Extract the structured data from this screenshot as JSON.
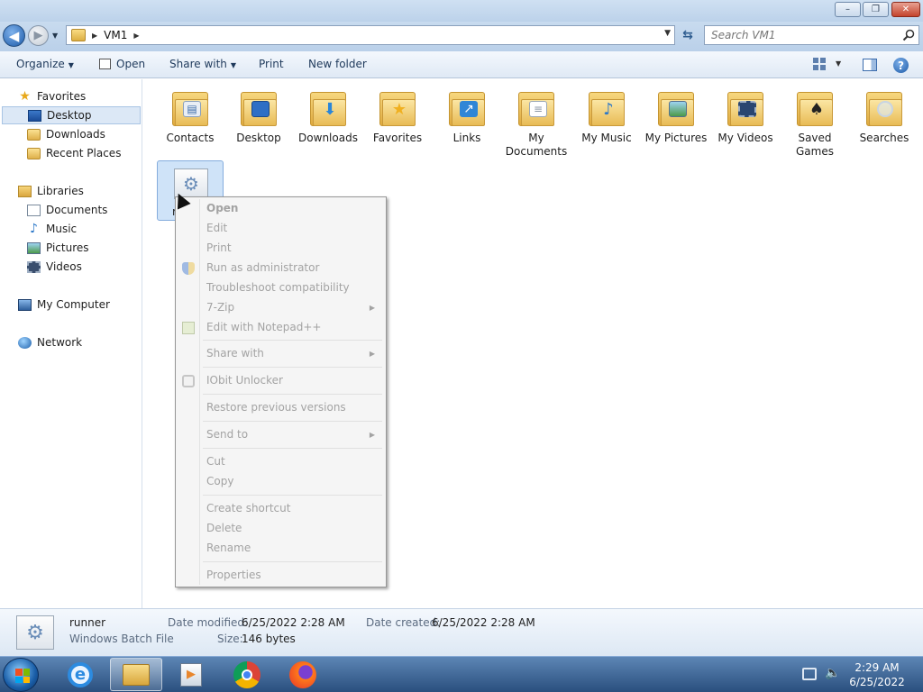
{
  "window": {
    "min": "–",
    "max": "❐",
    "close": "✕"
  },
  "address": {
    "segment": "VM1"
  },
  "search": {
    "placeholder": "Search VM1"
  },
  "toolbar": {
    "organize": "Organize",
    "open": "Open",
    "share_with": "Share with",
    "print": "Print",
    "new_folder": "New folder"
  },
  "sidebar": {
    "favorites": "Favorites",
    "desktop": "Desktop",
    "downloads": "Downloads",
    "recent": "Recent Places",
    "libraries": "Libraries",
    "documents": "Documents",
    "music": "Music",
    "pictures": "Pictures",
    "videos": "Videos",
    "computer": "My Computer",
    "network": "Network"
  },
  "folders": [
    "Contacts",
    "Desktop",
    "Downloads",
    "Favorites",
    "Links",
    "My Documents",
    "My Music",
    "My Pictures",
    "My Videos",
    "Saved Games",
    "Searches"
  ],
  "selected_file": {
    "name": "runner"
  },
  "context_menu": {
    "open": "Open",
    "edit": "Edit",
    "print": "Print",
    "run_as_admin": "Run as administrator",
    "troubleshoot": "Troubleshoot compatibility",
    "zip": "7-Zip",
    "notepadpp": "Edit with Notepad++",
    "share_with": "Share with",
    "iobit": "IObit Unlocker",
    "restore": "Restore previous versions",
    "send_to": "Send to",
    "cut": "Cut",
    "copy": "Copy",
    "create_shortcut": "Create shortcut",
    "delete": "Delete",
    "rename": "Rename",
    "properties": "Properties"
  },
  "details": {
    "name": "runner",
    "type": "Windows Batch File",
    "modified_label": "Date modified:",
    "modified": "6/25/2022 2:28 AM",
    "created_label": "Date created:",
    "created": "6/25/2022 2:28 AM",
    "size_label": "Size:",
    "size": "146 bytes"
  },
  "clock": {
    "time": "2:29 AM",
    "date": "6/25/2022"
  }
}
